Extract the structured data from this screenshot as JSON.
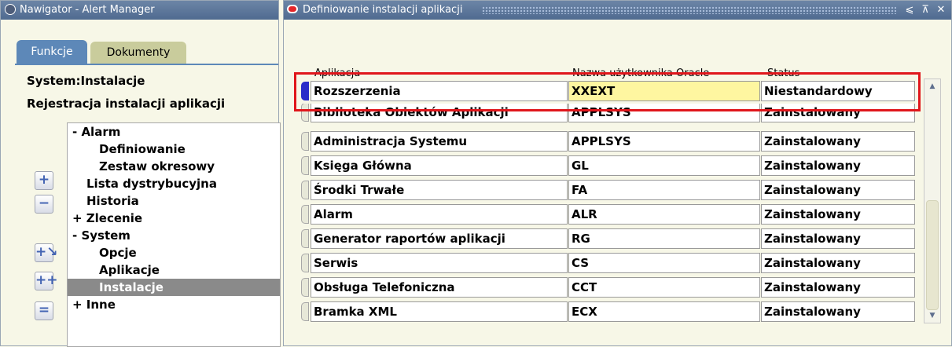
{
  "nav_window": {
    "title": "Nawigator - Alert Manager",
    "tabs": [
      "Funkcje",
      "Dokumenty"
    ],
    "system_label": "System:Instalacje",
    "section_label": "Rejestracja instalacji aplikacji",
    "tree": [
      {
        "label": "- Alarm"
      },
      {
        "label": "Definiowanie"
      },
      {
        "label": "Zestaw okresowy"
      },
      {
        "label": "Lista dystrybucyjna"
      },
      {
        "label": "Historia"
      },
      {
        "label": "+ Zlecenie"
      },
      {
        "label": "- System"
      },
      {
        "label": "Opcje"
      },
      {
        "label": "Aplikacje"
      },
      {
        "label": "Instalacje"
      },
      {
        "label": "+ Inne"
      }
    ],
    "side_buttons": [
      {
        "icon": "plus-icon"
      },
      {
        "icon": "minus-icon"
      },
      {
        "icon": "expand-branch-icon"
      },
      {
        "icon": "expand-all-icon"
      },
      {
        "icon": "collapse-all-icon"
      }
    ]
  },
  "def_window": {
    "title": "Definiowanie instalacji aplikacji",
    "controls": {
      "minimize": "⩽",
      "maximize": "⊼",
      "close": "✕"
    },
    "columns": [
      "Aplikacja",
      "Nazwa użytkownika Oracle",
      "Status"
    ],
    "rows": [
      {
        "app": "Rozszerzenia",
        "user": "XXEXT",
        "status": "Niestandardowy"
      },
      {
        "app": "Biblioteka Obiektów Aplikacji",
        "user": "APPLSYS",
        "status": "Zainstalowany"
      },
      {
        "app": "Administracja Systemu",
        "user": "APPLSYS",
        "status": "Zainstalowany"
      },
      {
        "app": "Księga Główna",
        "user": "GL",
        "status": "Zainstalowany"
      },
      {
        "app": "Środki Trwałe",
        "user": "FA",
        "status": "Zainstalowany"
      },
      {
        "app": "Alarm",
        "user": "ALR",
        "status": "Zainstalowany"
      },
      {
        "app": "Generator raportów aplikacji",
        "user": "RG",
        "status": "Zainstalowany"
      },
      {
        "app": "Serwis",
        "user": "CS",
        "status": "Zainstalowany"
      },
      {
        "app": "Obsługa Telefoniczna",
        "user": "CCT",
        "status": "Zainstalowany"
      },
      {
        "app": "Bramka XML",
        "user": "ECX",
        "status": "Zainstalowany"
      }
    ]
  },
  "colors": {
    "highlight_border": "#e0161b",
    "current_field": "#fef6a0",
    "record_indicator": "#2a2cc9"
  }
}
